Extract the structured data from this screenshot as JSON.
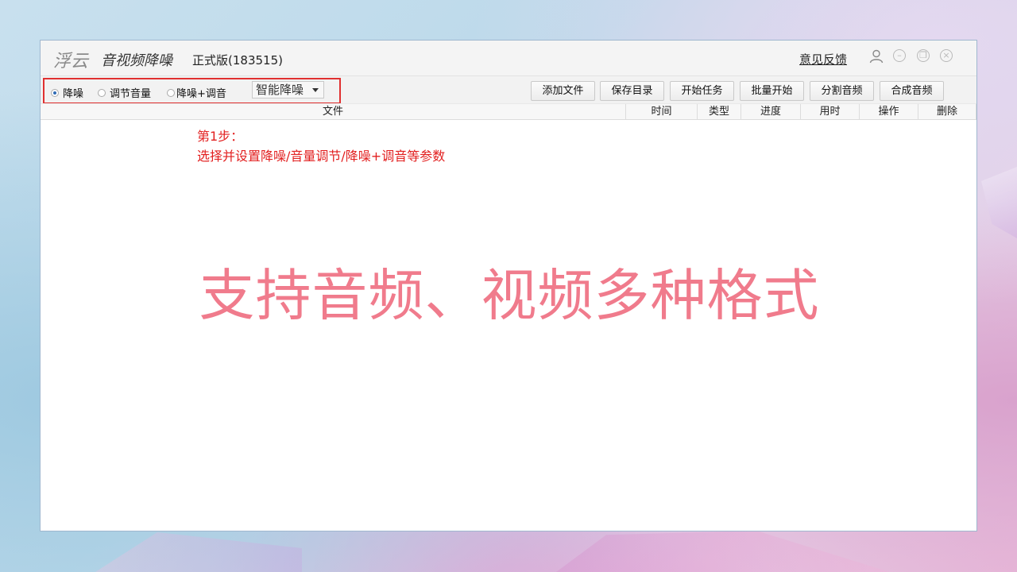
{
  "app": {
    "logo": "浮云",
    "name": "音视频降噪",
    "version": "正式版(183515)",
    "feedback_label": "意见反馈"
  },
  "window_controls": [
    "user-icon",
    "minimize-icon",
    "maximize-icon",
    "close-icon"
  ],
  "options": {
    "radios": [
      {
        "label": "降噪",
        "selected": true
      },
      {
        "label": "调节音量",
        "selected": false
      },
      {
        "label": "降噪+调音",
        "selected": false
      }
    ],
    "mode_select": "智能降噪"
  },
  "toolbar": {
    "add_file": "添加文件",
    "save_dir": "保存目录",
    "start_task": "开始任务",
    "batch_start": "批量开始",
    "split_audio": "分割音频",
    "merge_audio": "合成音频"
  },
  "table": {
    "columns": [
      "文件",
      "时间",
      "类型",
      "进度",
      "用时",
      "操作",
      "删除"
    ],
    "rows": []
  },
  "annotation": {
    "step_title": "第1步：",
    "step_text": "选择并设置降噪/音量调节/降噪+调音等参数"
  },
  "banner": "支持音频、视频多种格式",
  "colors": {
    "annotation_red": "#e21f1f",
    "banner_pink": "#f07b8c",
    "radio_selected": "#2f6bb5"
  }
}
